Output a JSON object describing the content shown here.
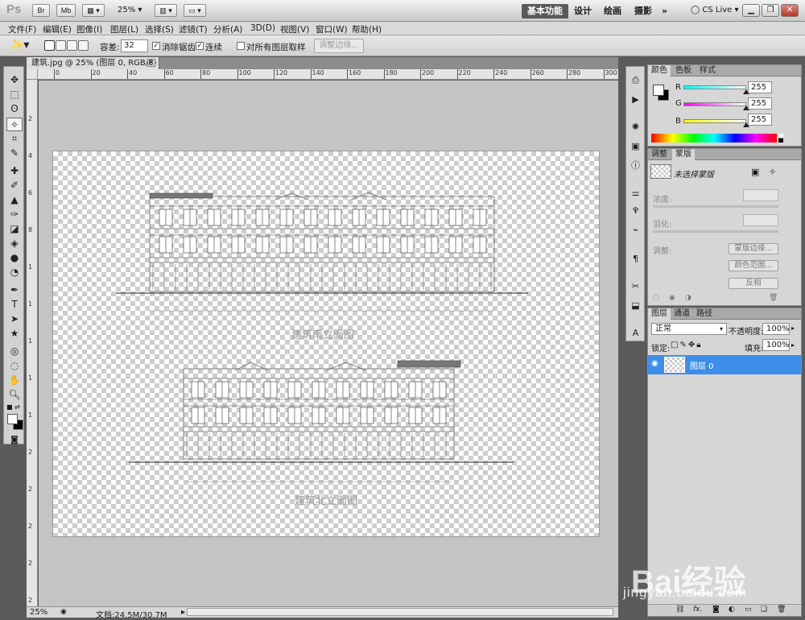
{
  "app": {
    "logo": "Ps",
    "bridge": "Br",
    "minibridge": "Mb",
    "zoom": "25%",
    "workspaces": [
      "基本功能",
      "设计",
      "绘画",
      "摄影"
    ],
    "more": "»",
    "cslive": "CS Live"
  },
  "menu": [
    "文件(F)",
    "编辑(E)",
    "图像(I)",
    "图层(L)",
    "选择(S)",
    "滤镜(T)",
    "分析(A)",
    "3D(D)",
    "视图(V)",
    "窗口(W)",
    "帮助(H)"
  ],
  "options": {
    "tolerance_label": "容差:",
    "tolerance_value": "32",
    "antialias": "消除锯齿",
    "contiguous": "连续",
    "sample_all": "对所有图层取样",
    "refine_edge": "调整边缘..."
  },
  "document": {
    "tab_title": "建筑.jpg @ 25% (图层 0, RGB/8) *",
    "ruler_h": [
      "0",
      "20",
      "40",
      "60",
      "80",
      "100",
      "120",
      "140",
      "160",
      "180",
      "200",
      "220",
      "240",
      "260",
      "280",
      "300",
      "3"
    ],
    "ruler_v": [
      "2",
      "4",
      "6",
      "8",
      "1",
      "1",
      "1",
      "1",
      "1",
      "2",
      "2",
      "2",
      "2",
      "2"
    ],
    "status_zoom": "25%",
    "status_doc": "文档:24.5M/30.7M",
    "drawing_top_caption": "建筑南立面图",
    "drawing_bottom_caption": "建筑北立面图"
  },
  "panels": {
    "color": {
      "tabs": [
        "颜色",
        "色板",
        "样式"
      ],
      "r_label": "R",
      "g_label": "G",
      "b_label": "B",
      "r": "255",
      "g": "255",
      "b": "255",
      "r_level": 1.0,
      "g_level": 1.0,
      "b_level": 1.0
    },
    "masks": {
      "tabs": [
        "调整",
        "蒙版"
      ],
      "status": "未选择蒙版",
      "density": "浓度:",
      "feather": "羽化:",
      "refine": "调整:",
      "btn_edge": "蒙版边缘...",
      "btn_range": "颜色范围...",
      "btn_invert": "反相"
    },
    "layers": {
      "tabs": [
        "图层",
        "通道",
        "路径"
      ],
      "blend": "正常",
      "opacity_label": "不透明度:",
      "opacity": "100%",
      "lock_label": "锁定:",
      "fill_label": "填充:",
      "fill": "100%",
      "layer_name": "图层 0"
    }
  },
  "watermark": {
    "brand": "Bai经验",
    "url": "jingyan.baidu.com"
  }
}
